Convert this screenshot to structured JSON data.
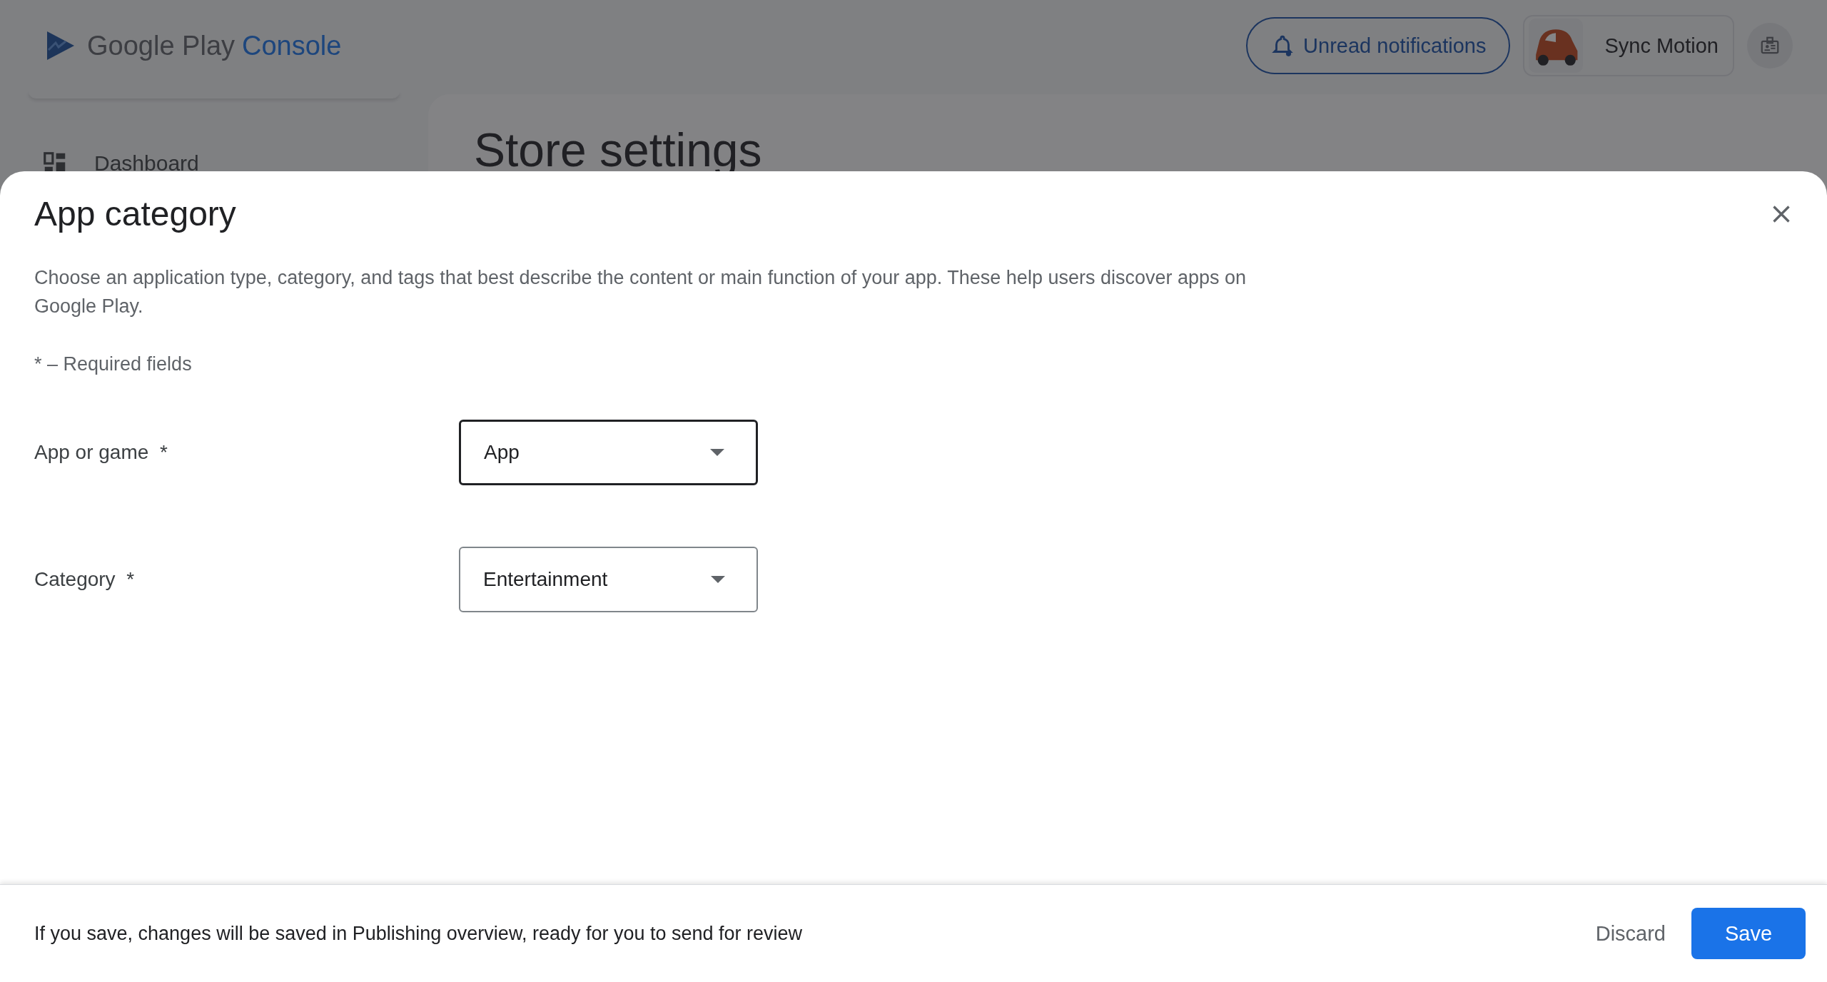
{
  "header": {
    "logo": {
      "brand": "Google Play",
      "product": "Console"
    },
    "notifications_button": "Unread notifications",
    "account": {
      "name": "Sync Motion"
    }
  },
  "sidebar": {
    "items": [
      {
        "label": "Dashboard"
      }
    ]
  },
  "page": {
    "title": "Store settings"
  },
  "dialog": {
    "title": "App category",
    "description": "Choose an application type, category, and tags that best describe the content or main function of your app. These help users discover apps on Google Play.",
    "required_note": "* – Required fields",
    "fields": [
      {
        "label": "App or game",
        "required_mark": "*",
        "value": "App",
        "focused": true
      },
      {
        "label": "Category",
        "required_mark": "*",
        "value": "Entertainment",
        "focused": false
      }
    ],
    "footer": {
      "message": "If you save, changes will be saved in Publishing overview, ready for you to send for review",
      "buttons": [
        {
          "label": "Discard",
          "kind": "text"
        },
        {
          "label": "Save",
          "kind": "primary"
        }
      ]
    }
  }
}
